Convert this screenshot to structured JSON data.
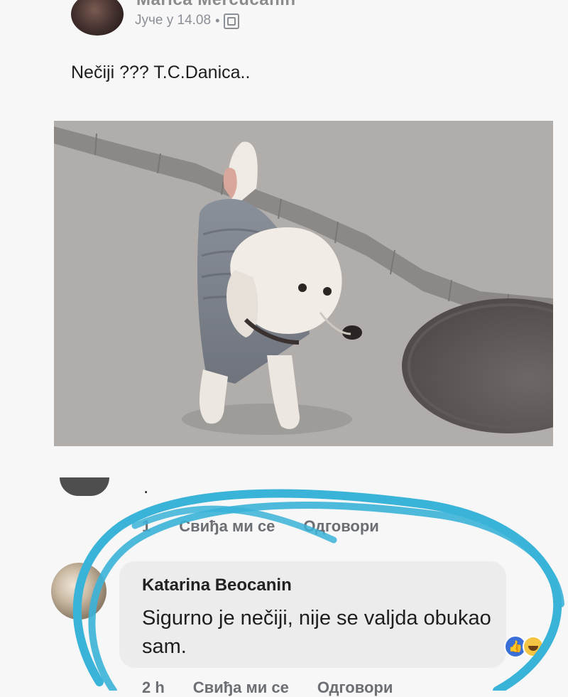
{
  "post": {
    "author": "Marica Mercucanin",
    "meta_time": "Јуче у 14.08",
    "meta_sep": "•",
    "text": "Nečiji ??? T.C.Danica..",
    "privacy_icon": "friends-icon"
  },
  "comment1": {
    "text": ".",
    "time": "1",
    "like_label": "Свиђа ми се",
    "reply_label": "Одговори"
  },
  "comment2": {
    "author": "Katarina Beocanin",
    "text": "Sigurno je nečiji, nije se valjda obukao sam.",
    "time": "2 h",
    "like_label": "Свиђа ми се",
    "reply_label": "Одговори",
    "reaction_icons": [
      "like-icon",
      "haha-icon"
    ]
  },
  "colors": {
    "highlight_ink": "#3ab3d8",
    "like_blue": "#3a6fd8"
  }
}
